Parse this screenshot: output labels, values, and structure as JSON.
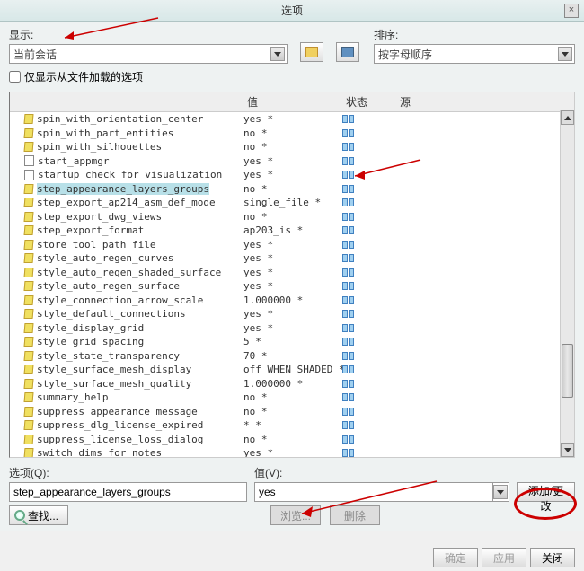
{
  "window": {
    "title": "选项"
  },
  "top": {
    "show_label": "显示:",
    "show_value": "当前会话",
    "sort_label": "排序:",
    "sort_value": "按字母顺序",
    "only_loaded": "仅显示从文件加载的选项"
  },
  "columns": {
    "name": "",
    "value": "值",
    "state": "状态",
    "source": "源"
  },
  "rows": [
    {
      "name": "spin_with_orientation_center",
      "value": "yes *",
      "doc": false,
      "sel": false
    },
    {
      "name": "spin_with_part_entities",
      "value": "no *",
      "doc": false,
      "sel": false
    },
    {
      "name": "spin_with_silhouettes",
      "value": "no *",
      "doc": false,
      "sel": false
    },
    {
      "name": "start_appmgr",
      "value": "yes *",
      "doc": true,
      "sel": false
    },
    {
      "name": "startup_check_for_visualization",
      "value": "yes *",
      "doc": true,
      "sel": false
    },
    {
      "name": "step_appearance_layers_groups",
      "value": "no *",
      "doc": false,
      "sel": true
    },
    {
      "name": "step_export_ap214_asm_def_mode",
      "value": "single_file *",
      "doc": false,
      "sel": false
    },
    {
      "name": "step_export_dwg_views",
      "value": "no *",
      "doc": false,
      "sel": false
    },
    {
      "name": "step_export_format",
      "value": "ap203_is *",
      "doc": false,
      "sel": false
    },
    {
      "name": "store_tool_path_file",
      "value": "yes *",
      "doc": false,
      "sel": false
    },
    {
      "name": "style_auto_regen_curves",
      "value": "yes *",
      "doc": false,
      "sel": false
    },
    {
      "name": "style_auto_regen_shaded_surface",
      "value": "yes *",
      "doc": false,
      "sel": false
    },
    {
      "name": "style_auto_regen_surface",
      "value": "yes *",
      "doc": false,
      "sel": false
    },
    {
      "name": "style_connection_arrow_scale",
      "value": "1.000000 *",
      "doc": false,
      "sel": false
    },
    {
      "name": "style_default_connections",
      "value": "yes *",
      "doc": false,
      "sel": false
    },
    {
      "name": "style_display_grid",
      "value": "yes *",
      "doc": false,
      "sel": false
    },
    {
      "name": "style_grid_spacing",
      "value": "5 *",
      "doc": false,
      "sel": false
    },
    {
      "name": "style_state_transparency",
      "value": "70 *",
      "doc": false,
      "sel": false
    },
    {
      "name": "style_surface_mesh_display",
      "value": "off WHEN SHADED *",
      "doc": false,
      "sel": false
    },
    {
      "name": "style_surface_mesh_quality",
      "value": "1.000000 *",
      "doc": false,
      "sel": false
    },
    {
      "name": "summary_help",
      "value": "no *",
      "doc": false,
      "sel": false
    },
    {
      "name": "suppress_appearance_message",
      "value": "no *",
      "doc": false,
      "sel": false
    },
    {
      "name": "suppress_dlg_license_expired",
      "value": "* *",
      "doc": false,
      "sel": false
    },
    {
      "name": "suppress_license_loss_dialog",
      "value": "no *",
      "doc": false,
      "sel": false
    },
    {
      "name": "switch_dims_for_notes",
      "value": "yes *",
      "doc": false,
      "sel": false
    }
  ],
  "edit": {
    "option_label": "选项(Q):",
    "option_value": "step_appearance_layers_groups",
    "value_label": "值(V):",
    "value_value": "yes",
    "add_change": "添加/更改",
    "find": "查找...",
    "browse": "浏览...",
    "delete": "删除"
  },
  "footer": {
    "ok": "确定",
    "apply": "应用",
    "close": "关闭"
  }
}
